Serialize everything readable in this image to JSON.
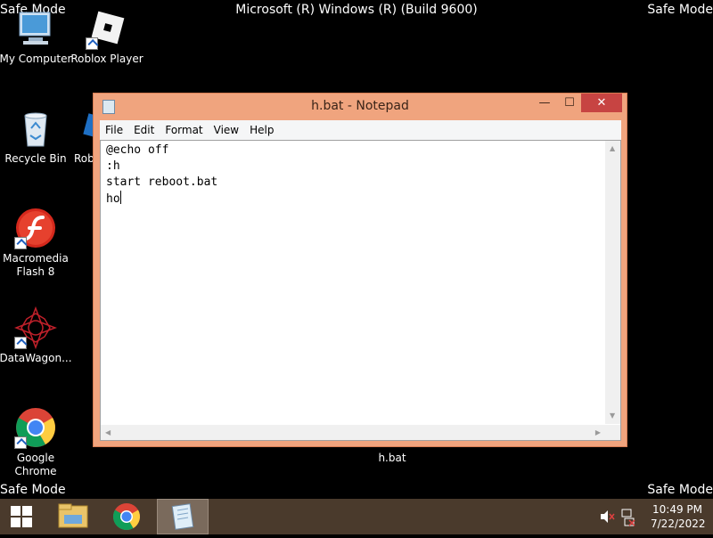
{
  "desktop": {
    "safe_mode_label": "Safe Mode",
    "header_title": "Microsoft (R) Windows (R) (Build 9600)",
    "icons": [
      {
        "label": "My Computer",
        "icon": "computer-icon"
      },
      {
        "label": "Roblox Player",
        "icon": "roblox-icon"
      },
      {
        "label": "Recycle Bin",
        "icon": "recycle-bin-icon"
      },
      {
        "label": "Robl",
        "icon": "roblox-icon"
      },
      {
        "label": "Macromedia Flash 8",
        "icon": "flash-icon"
      },
      {
        "label": "DataWagon...",
        "icon": "datawagon-icon"
      },
      {
        "label": "Google Chrome",
        "icon": "chrome-icon"
      }
    ],
    "file_caption": "h.bat"
  },
  "notepad": {
    "title": "h.bat - Notepad",
    "menu": [
      "File",
      "Edit",
      "Format",
      "View",
      "Help"
    ],
    "content": "@echo off\n:h\nstart reboot.bat\nho",
    "controls": {
      "minimize": "—",
      "maximize": "☐",
      "close": "✕"
    }
  },
  "taskbar": {
    "clock_time": "10:49 PM",
    "clock_date": "7/22/2022",
    "pinned": [
      "start-icon",
      "file-explorer-icon",
      "chrome-icon",
      "notepad-icon"
    ],
    "tray_icons": [
      "volume-muted-icon",
      "network-disconnected-icon"
    ]
  },
  "colors": {
    "window_frame": "#f0a47e",
    "close_button": "#c74442",
    "taskbar": "#4a3a2c"
  }
}
